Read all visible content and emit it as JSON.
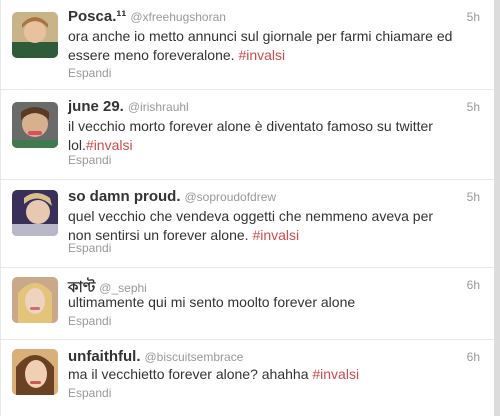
{
  "colors": {
    "hashtag": "#d04b4b",
    "meta": "#999999",
    "text": "#333333"
  },
  "tweets": [
    {
      "name": "Posca.¹¹",
      "handle": "@xfreehugshoran",
      "time": "5h",
      "text": "ora anche io metto annunci sul giornale per farmi chiamare ed essere meno foreveralone.",
      "hashtag": "#invalsi",
      "expand": "Espandi"
    },
    {
      "name": "june 29.",
      "handle": "@irishrauhl",
      "time": "5h",
      "text": "il vecchio morto forever alone è diventato famoso su twitter lol.",
      "hashtag": "#invalsi",
      "expand": "Espandi"
    },
    {
      "name": "so damn proud.",
      "handle": "@soproudofdrew",
      "time": "5h",
      "text": "quel vecchio che vendeva oggetti che nemmeno aveva per non sentirsi un forever alone.",
      "hashtag": "#invalsi",
      "expand": "Espandi"
    },
    {
      "name": "কাণ্ট",
      "handle": "@_sephi",
      "time": "6h",
      "text": "ultimamente qui mi sento moolto forever alone",
      "hashtag": "",
      "expand": "Espandi"
    },
    {
      "name": "unfaithful.",
      "handle": "@biscuitsembrace",
      "time": "6h",
      "text": "ma il vecchietto forever alone? ahahha",
      "hashtag": "#invalsi",
      "expand": "Espandi"
    }
  ]
}
